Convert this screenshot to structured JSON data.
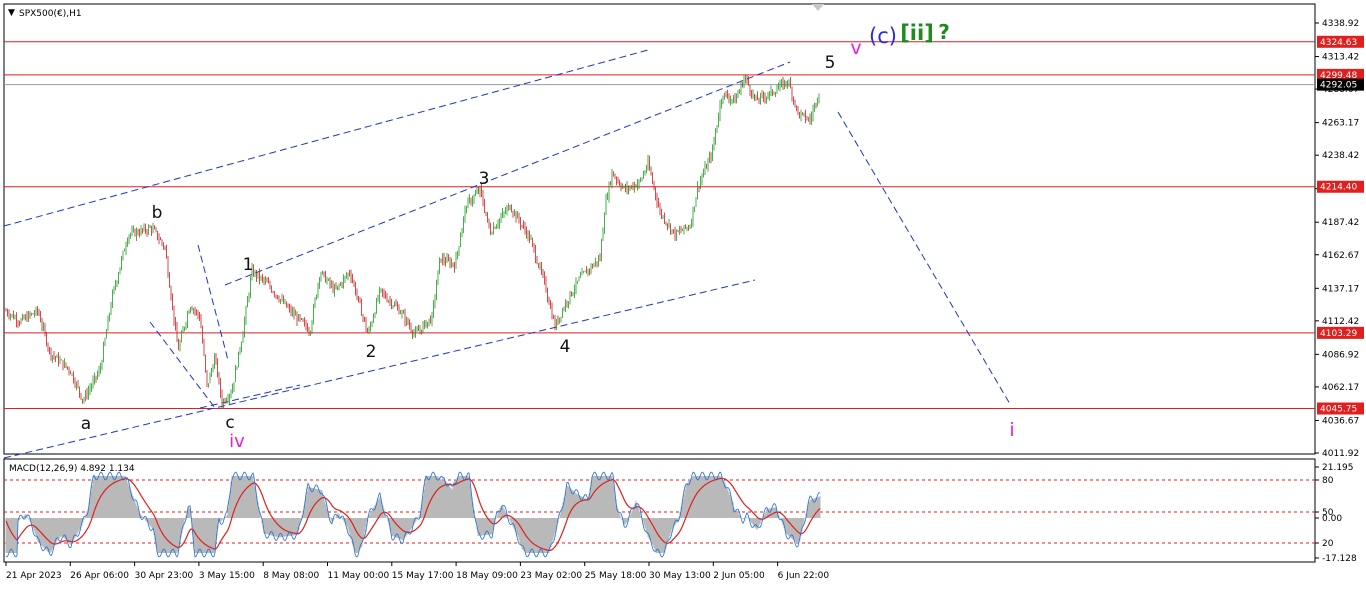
{
  "window": {
    "symbol_title": "SPX500(€),H1",
    "collapse_glyph": "▼"
  },
  "colors": {
    "up_candle": "#1f9a1f",
    "down_candle": "#c81e1e",
    "level_line": "#e01f1f",
    "channel": "#1e35c8",
    "macd_hist": "#b9b9b9",
    "macd_signal": "#e01f1f",
    "macd_line": "#1e6fd8",
    "label_black": "#111111",
    "label_magenta": "#e020e0",
    "label_blue": "#2a2ad8",
    "label_green": "#1f8a1f"
  },
  "price_axis": {
    "ticks": [
      "4338.92",
      "4313.42",
      "4288.67",
      "4263.17",
      "4238.42",
      "4212.92",
      "4187.42",
      "4162.67",
      "4137.17",
      "4112.42",
      "4086.92",
      "4062.17",
      "4036.67",
      "4011.92"
    ],
    "levels": [
      {
        "price": 4324.63,
        "label": "4324.63"
      },
      {
        "price": 4299.48,
        "label": "4299.48"
      },
      {
        "price": 4214.4,
        "label": "4214.40"
      },
      {
        "price": 4103.29,
        "label": "4103.29"
      },
      {
        "price": 4045.75,
        "label": "4045.75"
      }
    ],
    "current_price": {
      "price": 4292.05,
      "label": "4292.05"
    }
  },
  "time_axis": {
    "labels": [
      "21 Apr 2023",
      "26 Apr 06:00",
      "30 Apr 23:00",
      "3 May 15:00",
      "8 May 08:00",
      "11 May 00:00",
      "15 May 17:00",
      "18 May 09:00",
      "23 May 02:00",
      "25 May 18:00",
      "30 May 13:00",
      "2 Jun 05:00",
      "6 Jun 22:00"
    ]
  },
  "wave_labels": {
    "a": "a",
    "b": "b",
    "c": "c",
    "iv": "iv",
    "w1": "1",
    "w2": "2",
    "w3": "3",
    "w4": "4",
    "w5": "5",
    "v": "v",
    "c_wave": "(c)",
    "ii": "[ii]",
    "q": "?",
    "i": "i"
  },
  "macd": {
    "title": "MACD(12,26,9) 4.892 1.134",
    "ticks": [
      "21.195",
      "80",
      "50",
      "0.00",
      "20",
      "-17.128"
    ],
    "levels": [
      80,
      50,
      20
    ]
  },
  "chart_data": {
    "type": "candlestick",
    "title": "SPX500(€),H1",
    "x_start": "21 Apr 2023",
    "x_end": "8 Jun 2023",
    "ylim": [
      4007,
      4350
    ],
    "key_points": [
      {
        "label": "a",
        "price": 4050
      },
      {
        "label": "b",
        "price": 4185
      },
      {
        "label": "c",
        "price": 4048
      },
      {
        "label": "1",
        "price": 4157
      },
      {
        "label": "2",
        "price": 4099
      },
      {
        "label": "3",
        "price": 4216
      },
      {
        "label": "4",
        "price": 4106
      },
      {
        "label": "5",
        "price": 4298
      },
      {
        "label": "last",
        "price": 4292.05
      }
    ],
    "horizontal_levels": [
      4324.63,
      4299.48,
      4214.4,
      4103.29,
      4045.75
    ],
    "projection_target": {
      "label": "i",
      "price": 4048
    }
  }
}
